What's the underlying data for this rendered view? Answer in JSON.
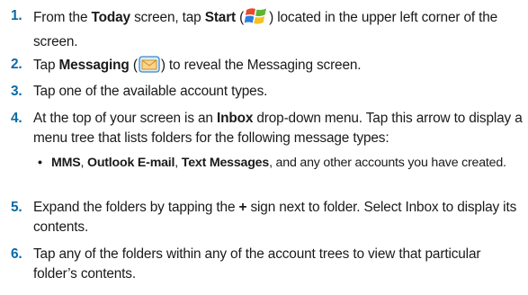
{
  "steps": [
    {
      "number": "1.",
      "pre": "From the ",
      "b1": "Today",
      "mid1": " screen, tap ",
      "b2": "Start",
      "mid2": " (",
      "icon": "windows-start-flag-icon",
      "post": ") located in the upper left corner of the screen."
    },
    {
      "number": "2.",
      "pre": "Tap ",
      "b1": "Messaging",
      "mid1": " (",
      "icon": "messaging-envelope-icon",
      "post": ") to reveal the Messaging screen."
    },
    {
      "number": "3.",
      "text": "Tap one of the available account types."
    },
    {
      "number": "4.",
      "pre": "At the top of your screen is an ",
      "b1": "Inbox",
      "post": " drop-down menu. Tap this arrow to display a menu tree that lists folders for the following message types:"
    },
    {
      "number": "5.",
      "pre": "Expand the folders by tapping the ",
      "b1": "+",
      "post": " sign next to folder. Select Inbox to display its contents."
    },
    {
      "number": "6.",
      "text": "Tap any of the folders within any of the account trees to view that particular folder’s contents."
    }
  ],
  "sub_item": {
    "bullet": "•",
    "b1": "MMS",
    "sep1": ", ",
    "b2": "Outlook E-mail",
    "sep2": ", ",
    "b3": "Text Messages",
    "post": ", and any other accounts you have created."
  },
  "colors": {
    "step_number": "#0a6aa6",
    "text": "#1a1a1a"
  }
}
